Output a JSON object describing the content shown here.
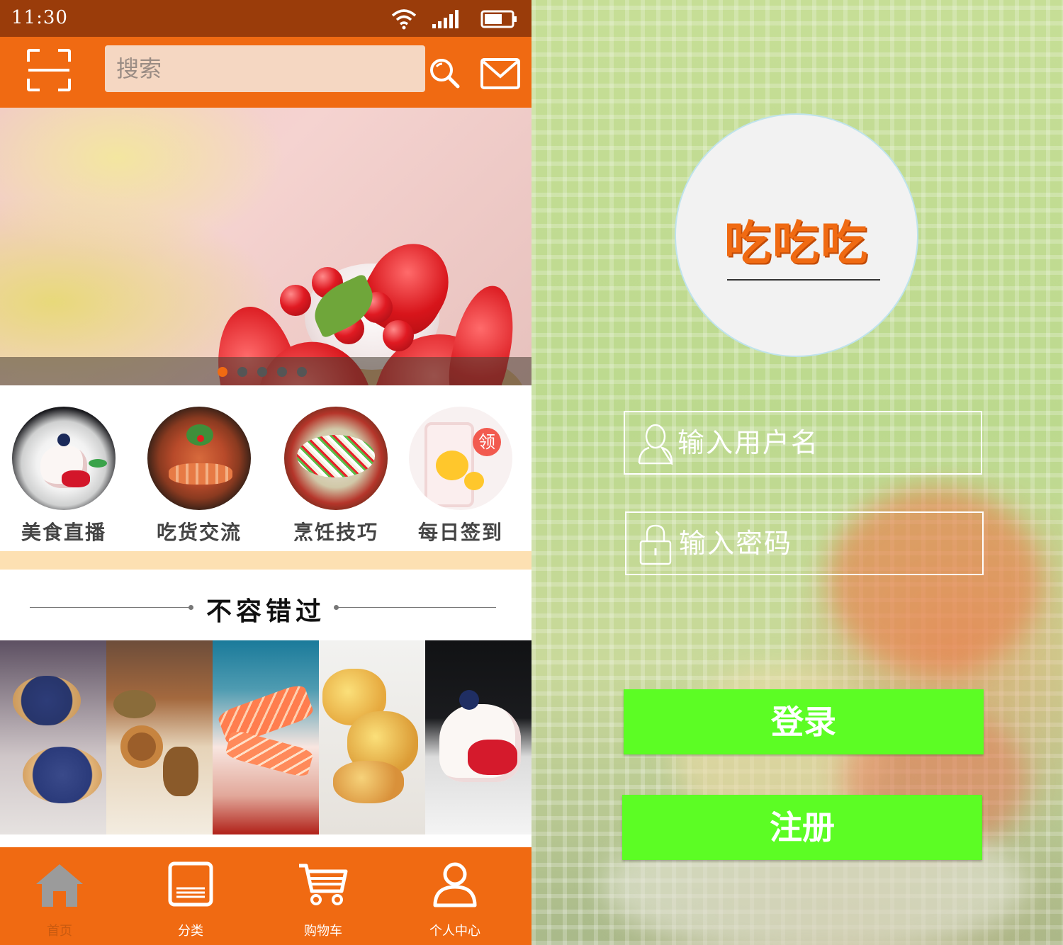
{
  "status_bar": {
    "time": "11:30"
  },
  "header": {
    "search_placeholder": "搜索"
  },
  "banner": {
    "dots": 5,
    "active_dot": 0
  },
  "categories": [
    {
      "label": "美食直播"
    },
    {
      "label": "吃货交流"
    },
    {
      "label": "烹饪技巧"
    },
    {
      "label": "每日签到",
      "badge": "领"
    }
  ],
  "section": {
    "title": "不容错过"
  },
  "tabbar": {
    "items": [
      {
        "label": "首页",
        "icon": "home-icon",
        "active": true
      },
      {
        "label": "分类",
        "icon": "list-icon",
        "active": false
      },
      {
        "label": "购物车",
        "icon": "cart-icon",
        "active": false
      },
      {
        "label": "个人中心",
        "icon": "person-icon",
        "active": false
      }
    ]
  },
  "login": {
    "app_name": "吃吃吃",
    "username_placeholder": "输入用户名",
    "password_placeholder": "输入密码",
    "login_label": "登录",
    "register_label": "注册"
  },
  "colors": {
    "brand_orange": "#f06a12",
    "status_bar": "#9a3c0a",
    "button_green": "#5cfd24",
    "stripe": "#fde0b2"
  }
}
